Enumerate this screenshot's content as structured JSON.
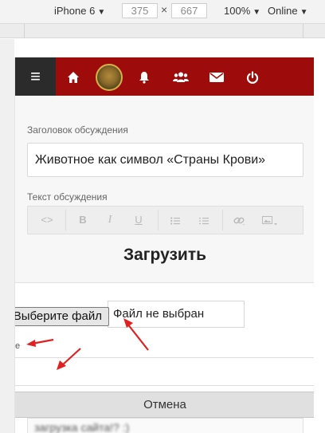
{
  "devtools": {
    "device": "iPhone 6",
    "width": "375",
    "height": "667",
    "times": "×",
    "zoom": "100%",
    "network": "Online"
  },
  "navbar": {
    "menu_icon": "bars-icon",
    "icons": [
      "home-icon",
      "avatar",
      "bell-icon",
      "users-icon",
      "envelope-icon",
      "power-icon"
    ],
    "background": "#9d0b0b"
  },
  "form": {
    "title_label": "Заголовок обсуждения",
    "title_value": "Животное как символ «Страны Крови»",
    "text_label": "Текст обсуждения",
    "toolbar": {
      "code": "<>",
      "bold": "B",
      "italic": "I",
      "underline": "U",
      "bullet_list": "☰",
      "numbered_list": "☰",
      "link": "🔗",
      "image": "🖼"
    }
  },
  "upload": {
    "heading": "Загрузить",
    "choose_button": "Выберите файл",
    "file_status": "Файл не выбран",
    "stray_text": "е",
    "cancel_button": "Отмена",
    "blurred_text": "загрузка сайта!? :)"
  },
  "annotations": {
    "arrow_color": "#e02020"
  }
}
